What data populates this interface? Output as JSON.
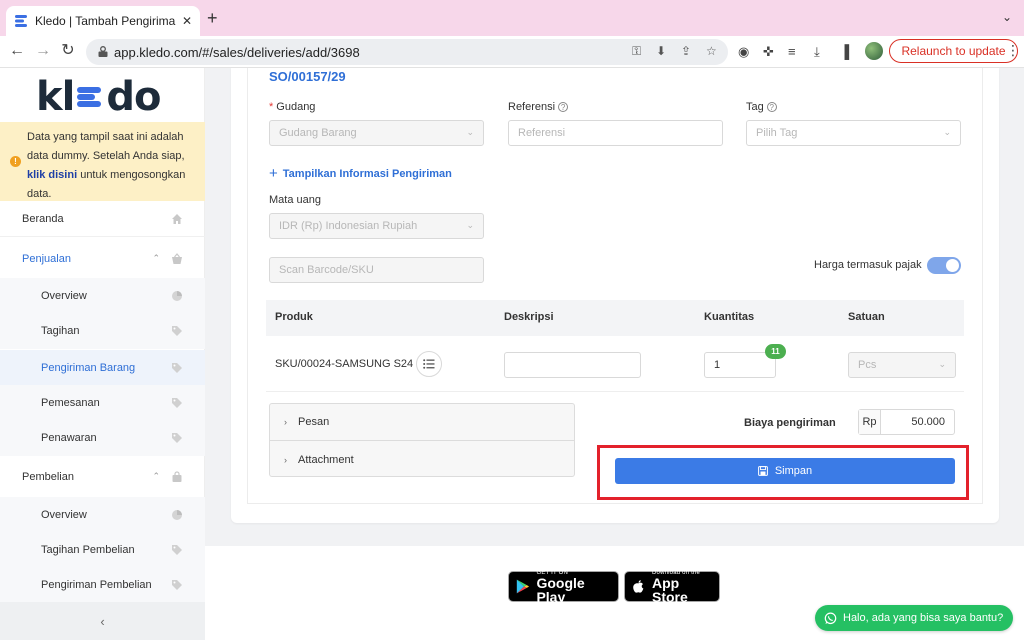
{
  "browser": {
    "tab_title": "Kledo | Tambah Pengiriman Barang",
    "url": "app.kledo.com/#/sales/deliveries/add/3698",
    "relaunch_label": "Relaunch to update"
  },
  "sidebar": {
    "logo": {
      "pre": "kl",
      "post": "do"
    },
    "notice": {
      "text_1": "Data yang tampil saat ini adalah data dummy. Setelah Anda siap, ",
      "link": "klik disini",
      "text_2": " untuk mengosongkan data."
    },
    "items": [
      {
        "label": "Beranda",
        "icon": "home-icon"
      },
      {
        "label": "Penjualan",
        "icon": "basket-icon"
      },
      {
        "label": "Overview",
        "icon": "pie-icon"
      },
      {
        "label": "Tagihan",
        "icon": "tag-icon"
      },
      {
        "label": "Pengiriman Barang",
        "icon": "tag-icon"
      },
      {
        "label": "Pemesanan",
        "icon": "tag-icon"
      },
      {
        "label": "Penawaran",
        "icon": "tag-icon"
      },
      {
        "label": "Pembelian",
        "icon": "bag-icon"
      },
      {
        "label": "Overview",
        "icon": "pie-icon"
      },
      {
        "label": "Tagihan Pembelian",
        "icon": "tag-icon"
      },
      {
        "label": "Pengiriman Pembelian",
        "icon": "tag-icon"
      }
    ],
    "collapse_glyph": "‹"
  },
  "form": {
    "so_number": "SO/00157/29",
    "gudang": {
      "label": "Gudang",
      "value": "Gudang Barang"
    },
    "referensi": {
      "label": "Referensi",
      "placeholder": "Referensi"
    },
    "tag": {
      "label": "Tag",
      "placeholder": "Pilih Tag"
    },
    "show_info": "Tampilkan Informasi Pengiriman",
    "currency": {
      "label": "Mata uang",
      "value": "IDR (Rp) Indonesian Rupiah"
    },
    "scan_placeholder": "Scan Barcode/SKU",
    "tax_inclusive": {
      "label": "Harga termasuk pajak",
      "on": true
    },
    "table": {
      "headers": [
        "Produk",
        "Deskripsi",
        "Kuantitas",
        "Satuan"
      ],
      "rows": [
        {
          "product": "SKU/00024-SAMSUNG S24",
          "description": "",
          "quantity": "1",
          "stock_badge": "11",
          "unit": "Pcs"
        }
      ]
    },
    "panels": [
      "Pesan",
      "Attachment"
    ],
    "shipping": {
      "label": "Biaya pengiriman",
      "prefix": "Rp",
      "value": "50.000"
    },
    "save_label": "Simpan"
  },
  "footer": {
    "google_play": {
      "small": "GET IT ON",
      "big": "Google Play"
    },
    "app_store": {
      "small": "Download on the",
      "big": "App Store"
    },
    "whatsapp": "Halo, ada yang bisa saya bantu?"
  },
  "colors": {
    "brand_blue": "#2f6fd6",
    "button_blue": "#3b7be6",
    "notice_bg": "#fdf0c6",
    "highlight_red": "#e3212b",
    "whatsapp_green": "#25c063"
  }
}
